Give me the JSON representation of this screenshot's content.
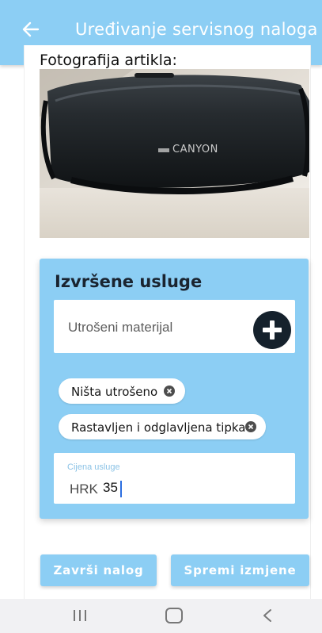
{
  "header": {
    "title": "Uređivanje servisnog naloga",
    "back_icon": "arrow-left-icon"
  },
  "photo": {
    "label": "Fotografija artikla:",
    "brand_text": "CANYON"
  },
  "services": {
    "title": "Izvršene usluge",
    "material_placeholder": "Utrošeni materijal",
    "add_icon": "plus-icon",
    "chips": [
      {
        "label": "Ništa utrošeno",
        "remove_icon": "close-circle-icon"
      },
      {
        "label": "Rastavljen i odglavljena tipka",
        "remove_icon": "close-circle-icon"
      }
    ],
    "price": {
      "label": "Cijena usluge",
      "currency": "HRK",
      "value": "35"
    }
  },
  "actions": {
    "finish_label": "Završi nalog",
    "save_label": "Spremi izmjene"
  },
  "navbar": {
    "recent_icon": "recent-apps-icon",
    "home_icon": "home-icon",
    "back_icon": "back-chevron-icon"
  },
  "colors": {
    "accent": "#8ccef4",
    "dark_fab": "#15212c",
    "white": "#ffffff"
  }
}
